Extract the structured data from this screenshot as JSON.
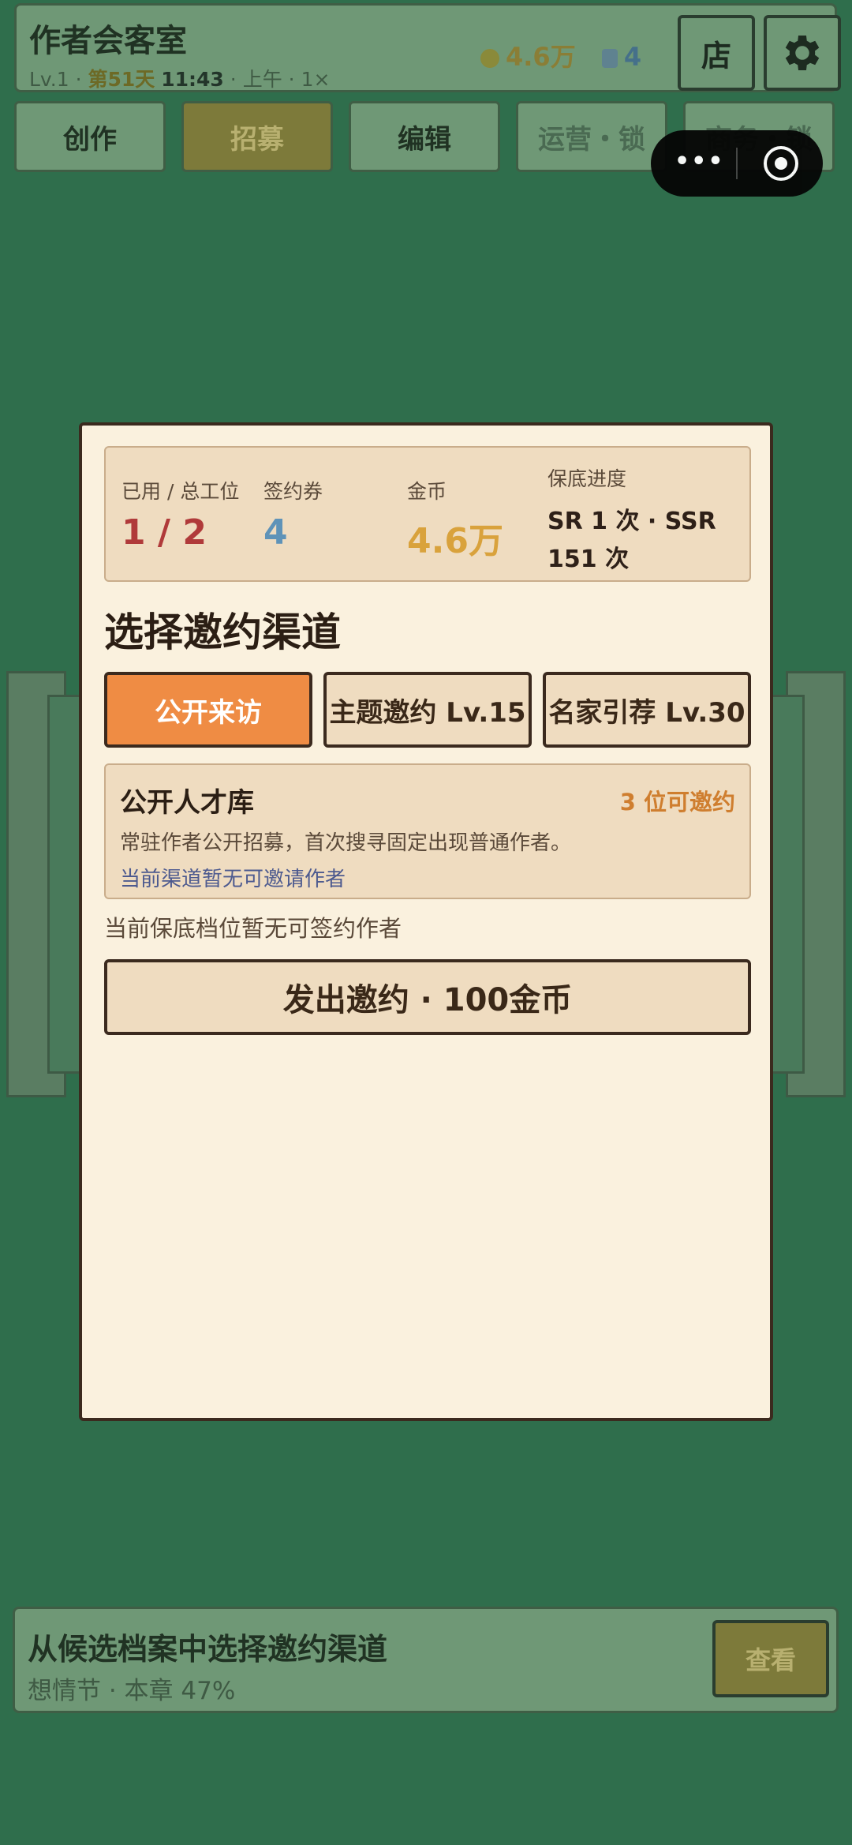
{
  "header": {
    "title": "作者会客室",
    "level": "Lv.1",
    "day": "第51天",
    "time": "11:43",
    "period": "上午",
    "speed": "1×",
    "coins": "4.6万",
    "tickets": "4",
    "shop_label": "店"
  },
  "tabs": [
    {
      "label": "创作"
    },
    {
      "label": "招募"
    },
    {
      "label": "编辑"
    },
    {
      "label": "运营・锁"
    },
    {
      "label": "商务・锁"
    }
  ],
  "modal": {
    "stats": {
      "slots_label": "已用 / 总工位",
      "slots_value": "1 / 2",
      "tickets_label": "签约券",
      "tickets_value": "4",
      "coins_label": "金币",
      "coins_value": "4.6万",
      "pity_label": "保底进度",
      "pity_value": "SR 1 次 · SSR 151 次"
    },
    "section_title": "选择邀约渠道",
    "channels": [
      {
        "label": "公开来访"
      },
      {
        "label": "主题邀约 Lv.15"
      },
      {
        "label": "名家引荐 Lv.30"
      }
    ],
    "pool": {
      "title": "公开人才库",
      "count": "3 位可邀约",
      "description": "常驻作者公开招募，首次搜寻固定出现普通作者。",
      "note": "当前渠道暂无可邀请作者"
    },
    "warning": "当前保底档位暂无可签约作者",
    "invite_button": "发出邀约 · 100金币"
  },
  "bottom": {
    "title": "从候选档案中选择邀约渠道",
    "subtitle": "想情节 · 本章 47%",
    "view_button": "查看"
  },
  "colors": {
    "background": "#2f6e4c",
    "panel": "#faf1de",
    "accent": "#ef8c44",
    "slots_red": "#b03a3a",
    "tickets_blue": "#5f93b8",
    "coins_gold": "#d9a23c"
  }
}
